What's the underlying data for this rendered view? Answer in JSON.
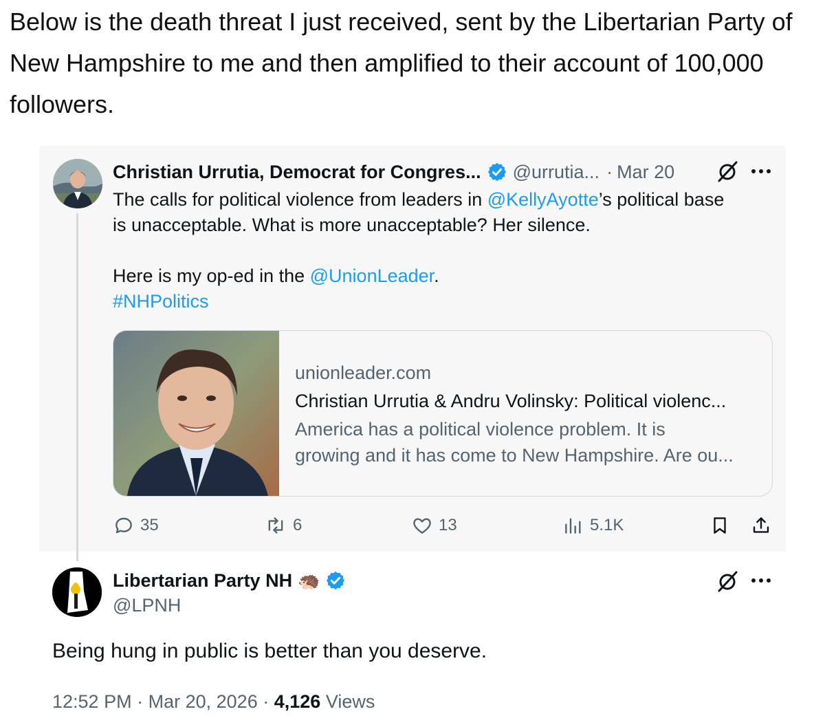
{
  "headline": "Below is the death threat I just received, sent by the Libertarian Party of New Hampshire to me and then amplified to their account of 100,000 followers.",
  "original_tweet": {
    "author_name": "Christian Urrutia, Democrat for Congres...",
    "handle": "@urrutia...",
    "separator": "·",
    "date": "Mar 20",
    "line1_before": "The calls for political violence from leaders in ",
    "line1_mention": "@KellyAyotte",
    "line1_after": "’s political base",
    "line2": "is unacceptable. What is more unacceptable? Her silence.",
    "line3_before": "Here is my op-ed in the ",
    "line3_mention": "@UnionLeader",
    "line3_after": ".",
    "hashtag": "#NHPolitics",
    "link_card": {
      "domain": "unionleader.com",
      "title": "Christian Urrutia & Andru Volinsky: Political violenc...",
      "description_line1": "America has a political violence problem. It is",
      "description_line2": "growing and it has come to New Hampshire. Are ou..."
    },
    "actions": {
      "replies": "35",
      "reposts": "6",
      "likes": "13",
      "views": "5.1K"
    }
  },
  "reply_tweet": {
    "author_name": "Libertarian Party NH",
    "emoji": "🦔",
    "handle": "@LPNH",
    "text": "Being hung in public is better than you deserve.",
    "time": "12:52 PM",
    "separator": "·",
    "date": "Mar 20, 2026",
    "views_count": "4,126",
    "views_label": "Views"
  },
  "colors": {
    "link": "#1d9bf0",
    "muted": "#536471",
    "verified": "#1d9bf0",
    "card_background": "#f7f7f7"
  }
}
